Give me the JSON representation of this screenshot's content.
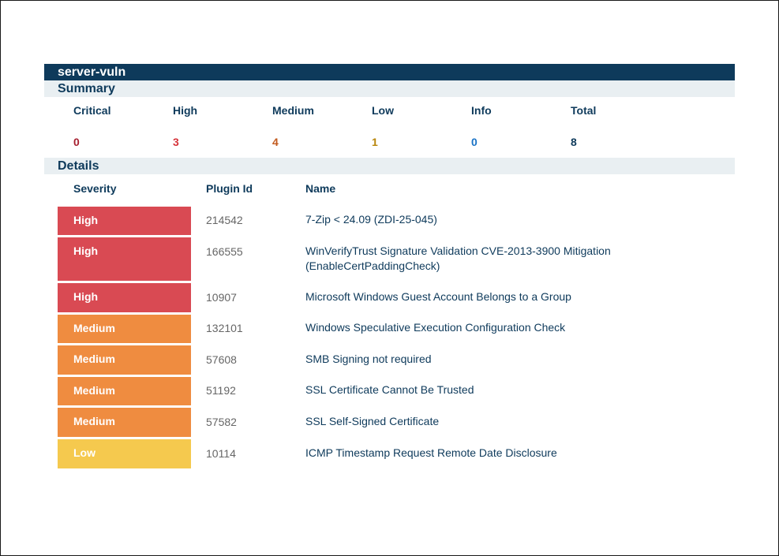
{
  "report": {
    "title": "server-vuln"
  },
  "sections": {
    "summary": "Summary",
    "details": "Details"
  },
  "summary": {
    "items": [
      {
        "label": "Critical",
        "count": "0",
        "color": "#a61f2f"
      },
      {
        "label": "High",
        "count": "3",
        "color": "#d6333a"
      },
      {
        "label": "Medium",
        "count": "4",
        "color": "#c25a1e"
      },
      {
        "label": "Low",
        "count": "1",
        "color": "#b8860b"
      },
      {
        "label": "Info",
        "count": "0",
        "color": "#1a73c6"
      },
      {
        "label": "Total",
        "count": "8",
        "color": "#0e3a5b"
      }
    ]
  },
  "details": {
    "headers": {
      "severity": "Severity",
      "plugin_id": "Plugin Id",
      "name": "Name"
    },
    "severity_colors": {
      "High": "#d94a53",
      "Medium": "#ef8c40",
      "Low": "#f5c94e"
    },
    "rows": [
      {
        "severity": "High",
        "plugin_id": "214542",
        "name": "7-Zip < 24.09 (ZDI-25-045)"
      },
      {
        "severity": "High",
        "plugin_id": "166555",
        "name": "WinVerifyTrust Signature Validation CVE-2013-3900 Mitigation (EnableCertPaddingCheck)"
      },
      {
        "severity": "High",
        "plugin_id": "10907",
        "name": "Microsoft Windows Guest Account Belongs to a Group"
      },
      {
        "severity": "Medium",
        "plugin_id": "132101",
        "name": "Windows Speculative Execution Configuration Check"
      },
      {
        "severity": "Medium",
        "plugin_id": "57608",
        "name": "SMB Signing not required"
      },
      {
        "severity": "Medium",
        "plugin_id": "51192",
        "name": "SSL Certificate Cannot Be Trusted"
      },
      {
        "severity": "Medium",
        "plugin_id": "57582",
        "name": "SSL Self-Signed Certificate"
      },
      {
        "severity": "Low",
        "plugin_id": "10114",
        "name": "ICMP Timestamp Request Remote Date Disclosure"
      }
    ]
  }
}
